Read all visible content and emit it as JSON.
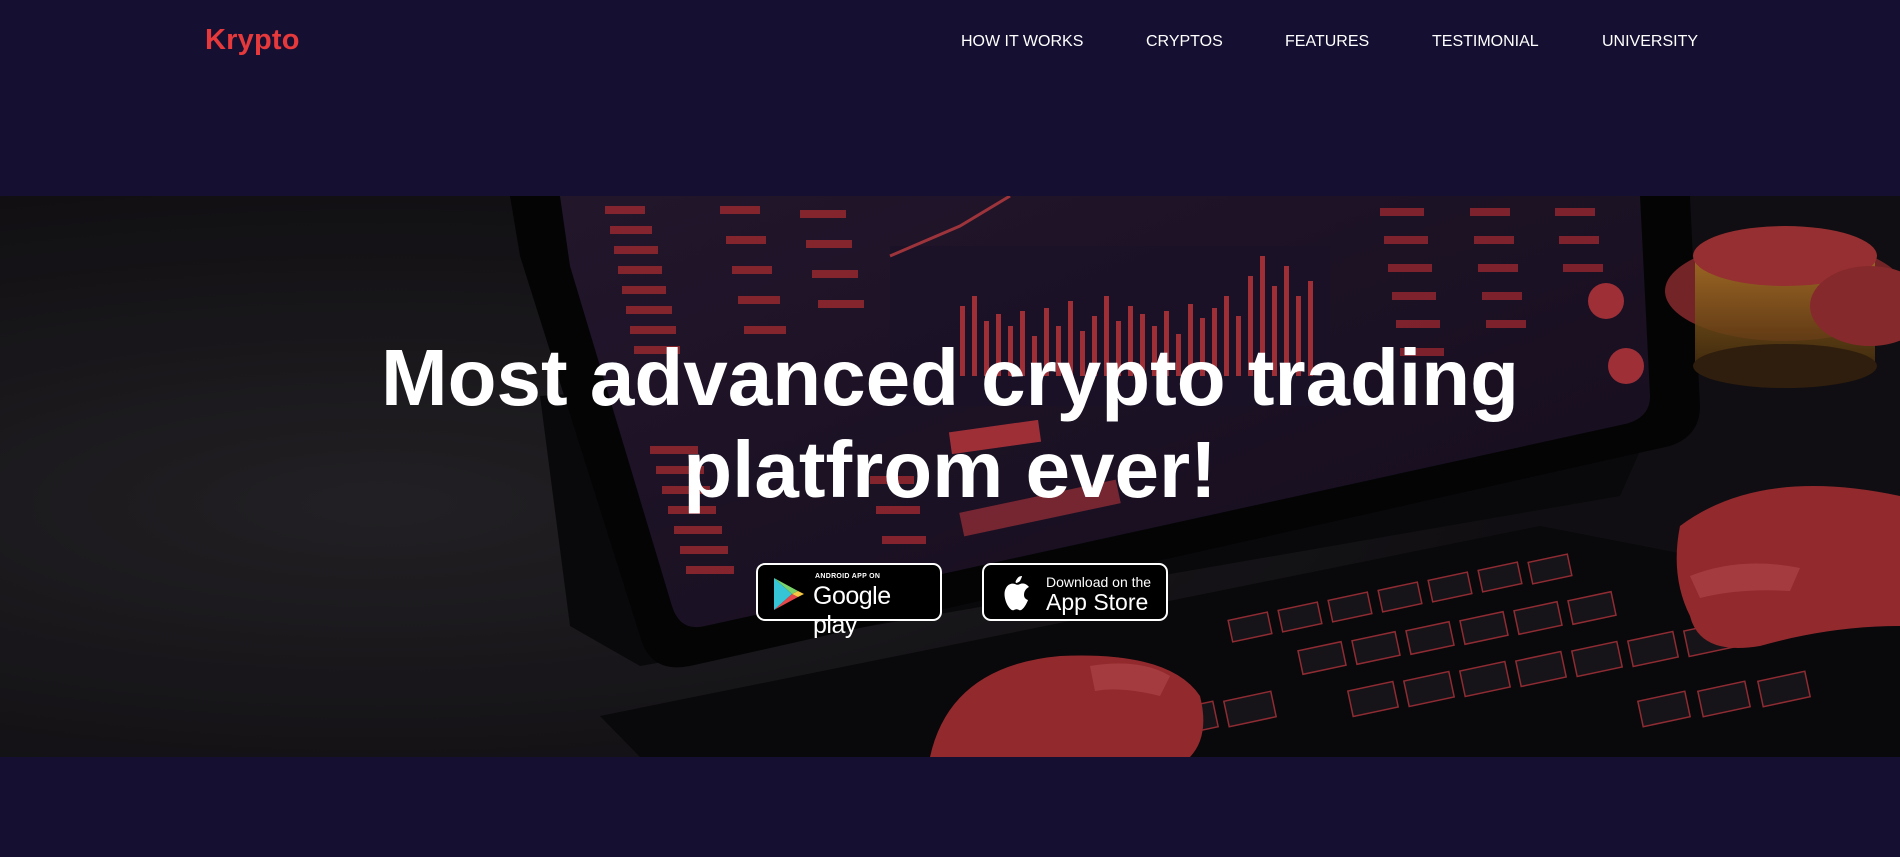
{
  "brand": {
    "name": "Krypto",
    "color": "#e5393c"
  },
  "nav": {
    "items": [
      {
        "label": "HOW IT WORKS"
      },
      {
        "label": "CRYPTOS"
      },
      {
        "label": "FEATURES"
      },
      {
        "label": "TESTIMONIAL"
      },
      {
        "label": "UNIVERSITY"
      }
    ]
  },
  "hero": {
    "title_line1": "Most advanced crypto trading",
    "title_line2": "platfrom ever!",
    "background": "hero-trading-tablet-image"
  },
  "store_buttons": {
    "google_play": {
      "small": "ANDROID APP ON",
      "big": "Google play",
      "icon": "google-play-icon"
    },
    "app_store": {
      "small": "Download on the",
      "big": "App Store",
      "icon": "apple-icon"
    }
  },
  "colors": {
    "background": "#150f32",
    "accent": "#e5393c",
    "text": "#ffffff"
  }
}
